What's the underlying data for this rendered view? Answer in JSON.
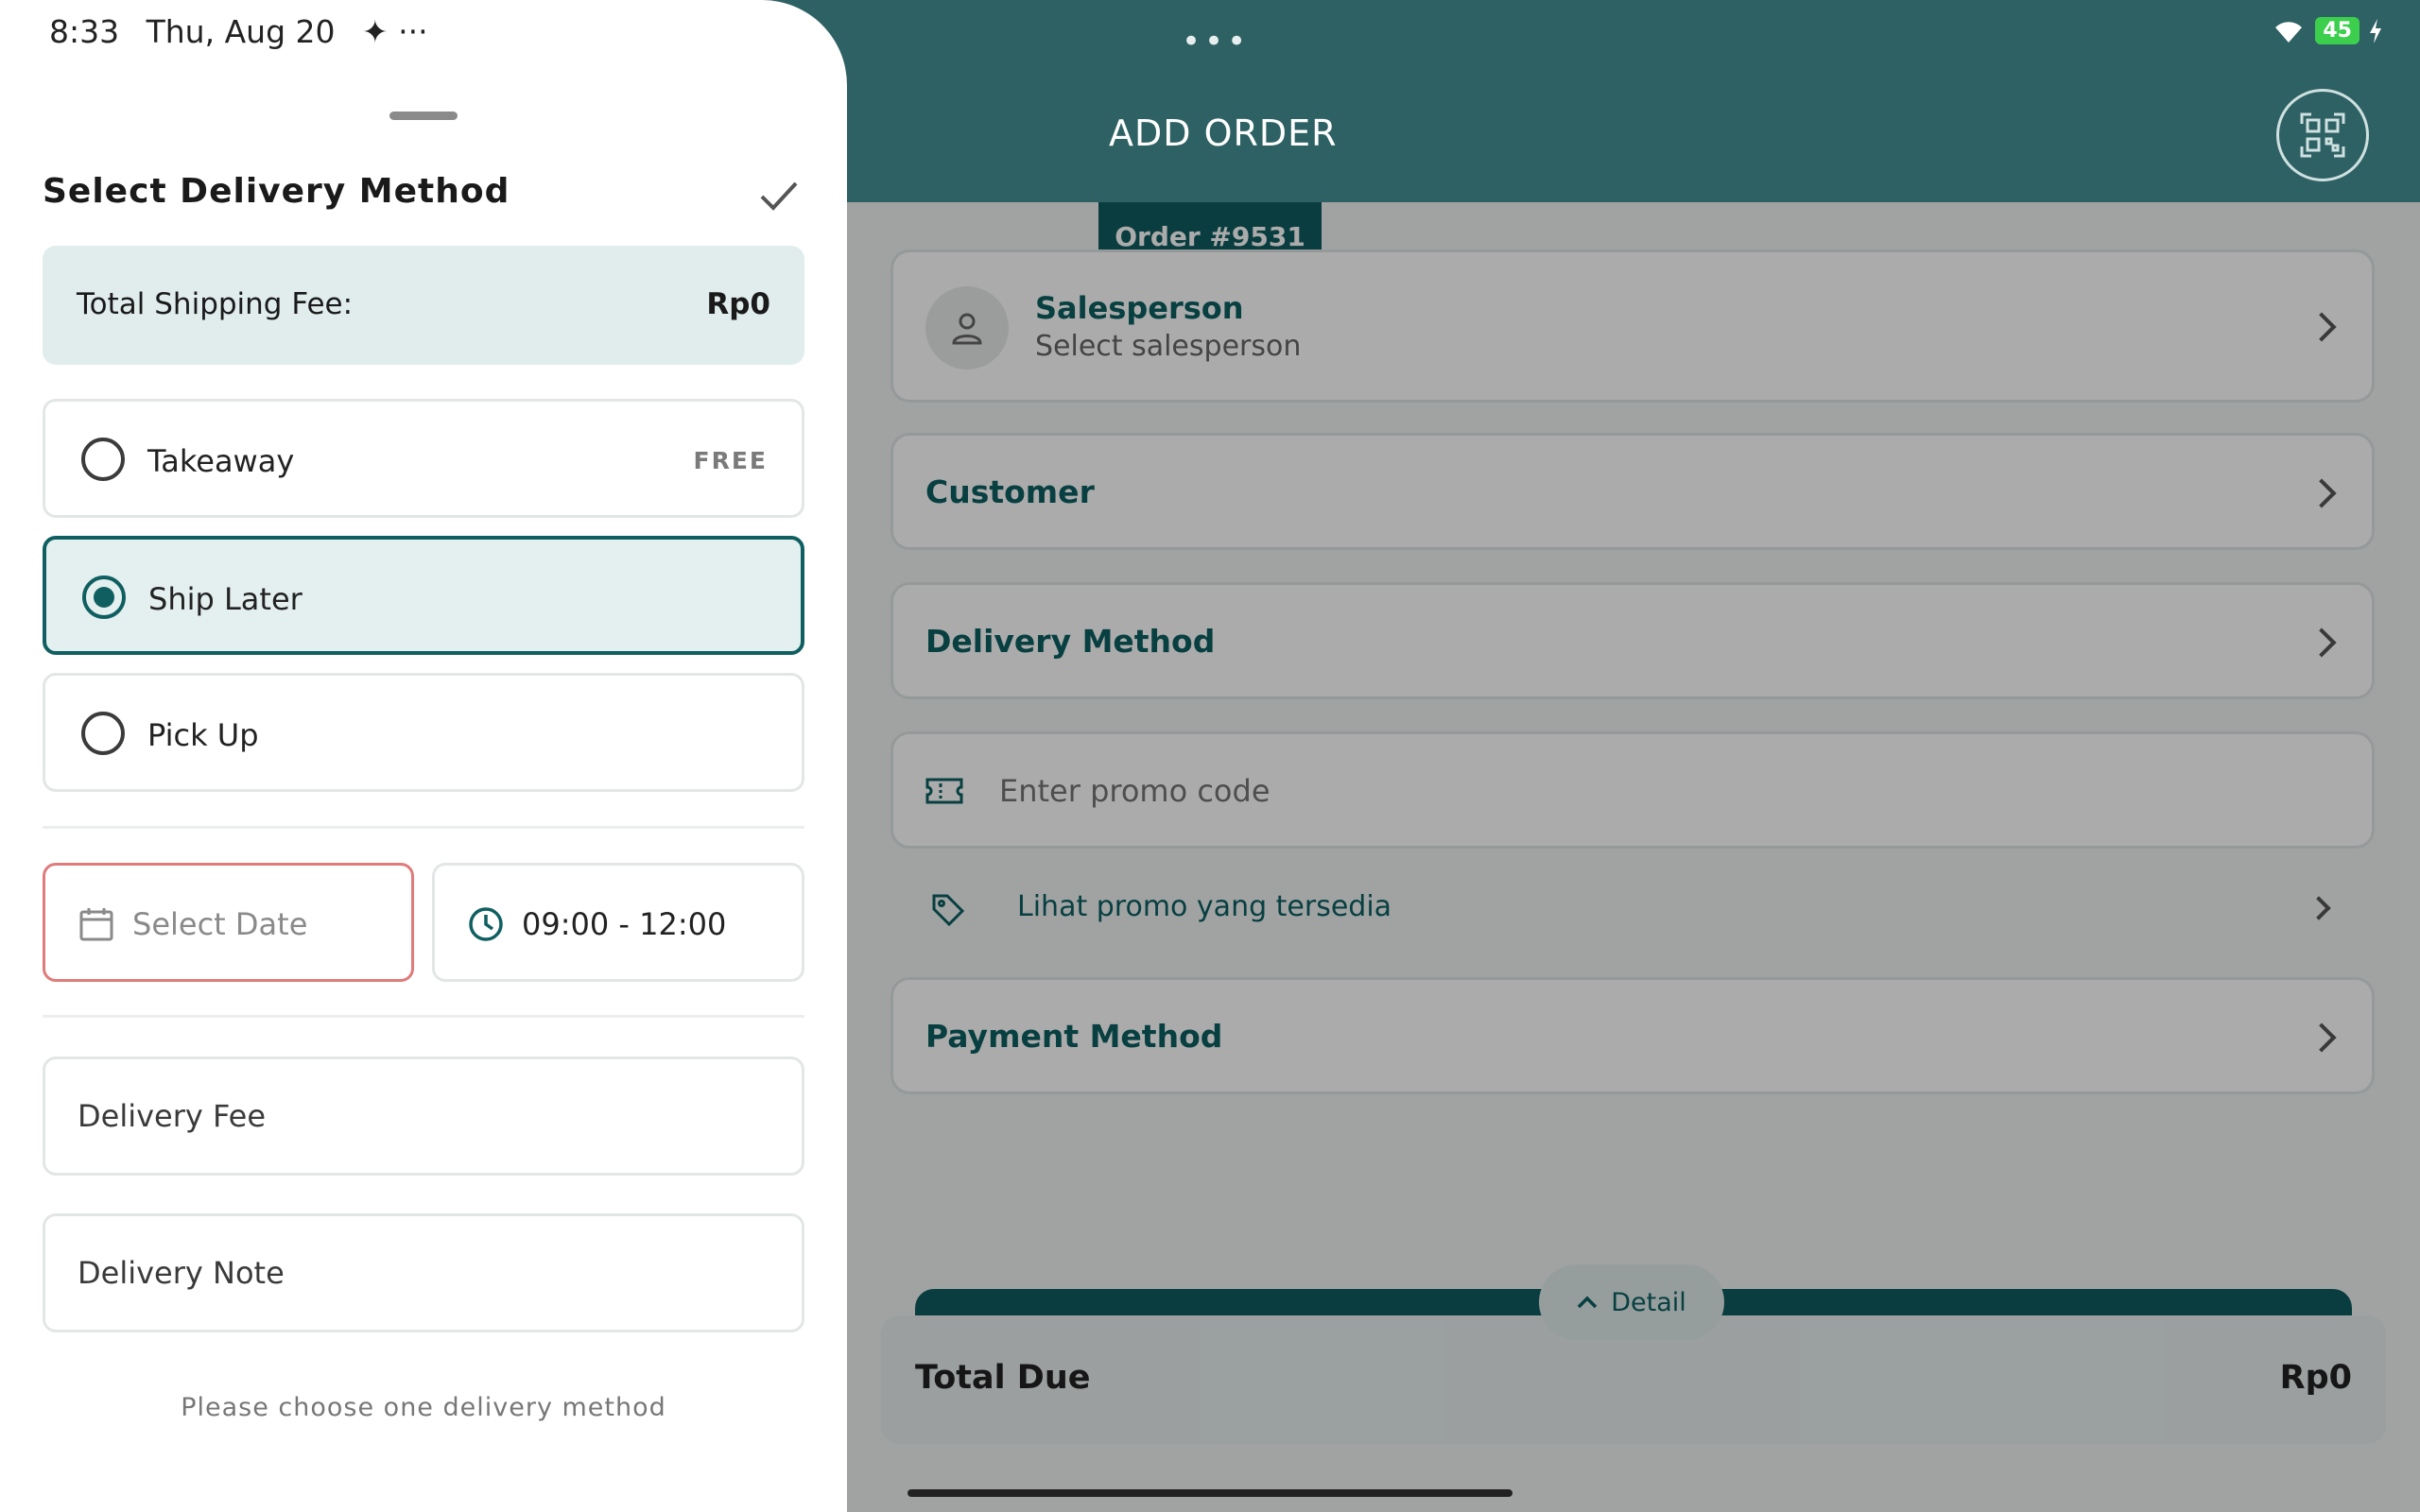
{
  "status_bar": {
    "time": "8:33",
    "date": "Thu, Aug 20",
    "extra": "✦ ···",
    "battery": "45",
    "center_dots": "•••"
  },
  "sheet": {
    "title": "Select Delivery Method",
    "shipping_fee_label": "Total Shipping Fee:",
    "shipping_fee_value": "Rp0",
    "options": [
      {
        "label": "Takeaway",
        "badge": "FREE",
        "selected": false
      },
      {
        "label": "Ship Later",
        "badge": "",
        "selected": true
      },
      {
        "label": "Pick Up",
        "badge": "",
        "selected": false
      }
    ],
    "date_placeholder": "Select Date",
    "time_value": "09:00 - 12:00",
    "delivery_fee_placeholder": "Delivery Fee",
    "delivery_note_placeholder": "Delivery Note",
    "hint": "Please choose one delivery method"
  },
  "app": {
    "title": "ADD ORDER",
    "order_tag": "Order #9531",
    "salesperson_title": "Salesperson",
    "salesperson_sub": "Select salesperson",
    "customer_label": "Customer",
    "delivery_label": "Delivery Method",
    "promo_placeholder": "Enter promo code",
    "promo_link": "Lihat promo yang tersedia",
    "payment_label": "Payment Method",
    "detail_label": "Detail",
    "total_label": "Total Due",
    "total_value": "Rp0"
  },
  "colors": {
    "primary": "#0f5f61",
    "header": "#2e6163",
    "selected_bg": "#e4efef",
    "error_border": "#e07b7b"
  },
  "icons": [
    "qr-scan-icon",
    "person-icon",
    "chevron-right-icon",
    "ticket-icon",
    "tag-icon",
    "chevron-up-icon",
    "check-icon",
    "calendar-icon",
    "clock-icon",
    "wifi-icon",
    "battery-icon"
  ]
}
